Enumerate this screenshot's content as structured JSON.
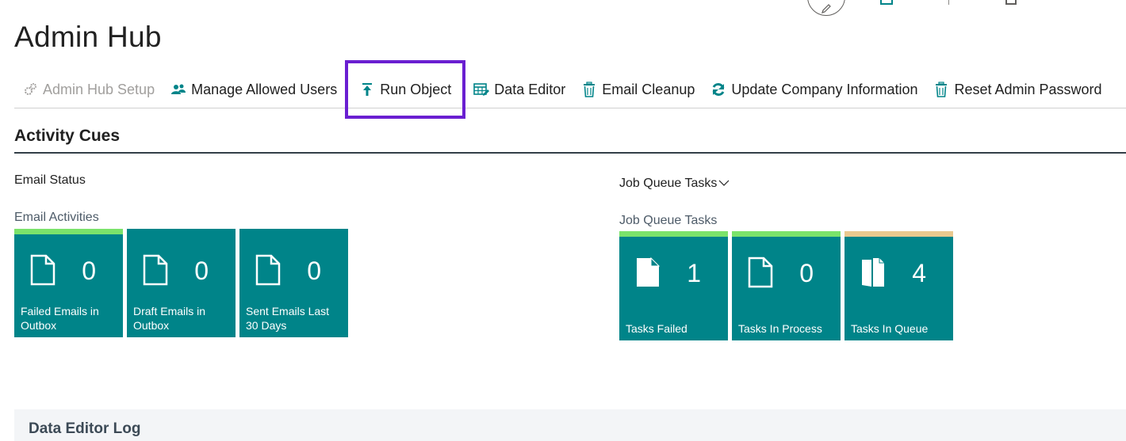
{
  "page": {
    "title": "Admin Hub"
  },
  "actions": [
    {
      "label": "Admin Hub Setup",
      "icon": "gears-icon",
      "disabled": true
    },
    {
      "label": "Manage Allowed Users",
      "icon": "users-icon"
    },
    {
      "label": "Run Object",
      "icon": "run-upload-icon",
      "highlighted": true
    },
    {
      "label": "Data Editor",
      "icon": "table-edit-icon"
    },
    {
      "label": "Email Cleanup",
      "icon": "trash-icon"
    },
    {
      "label": "Update Company Information",
      "icon": "refresh-icon"
    },
    {
      "label": "Reset Admin Password",
      "icon": "trash-icon"
    }
  ],
  "section": {
    "title": "Activity Cues"
  },
  "email_group": {
    "heading": "Email Status",
    "subheading": "Email Activities",
    "tiles": [
      {
        "value": "0",
        "label": "Failed Emails in Outbox",
        "stripe_color": "#7be36b",
        "icon": "document-outline-icon"
      },
      {
        "value": "0",
        "label": "Draft Emails in Outbox",
        "stripe_color": "#008489",
        "icon": "document-outline-icon"
      },
      {
        "value": "0",
        "label": "Sent Emails Last 30 Days",
        "stripe_color": "#008489",
        "icon": "document-outline-icon"
      }
    ]
  },
  "jobqueue_group": {
    "heading": "Job Queue Tasks",
    "subheading": "Job Queue Tasks",
    "tiles": [
      {
        "value": "1",
        "label": "Tasks Failed",
        "stripe_color": "#7be36b",
        "icon": "document-filled-icon"
      },
      {
        "value": "0",
        "label": "Tasks In Process",
        "stripe_color": "#7be36b",
        "icon": "document-outline-icon"
      },
      {
        "value": "4",
        "label": "Tasks In Queue",
        "stripe_color": "#e9c98f",
        "icon": "documents-stack-icon"
      }
    ]
  },
  "log_panel": {
    "title": "Data Editor Log"
  }
}
